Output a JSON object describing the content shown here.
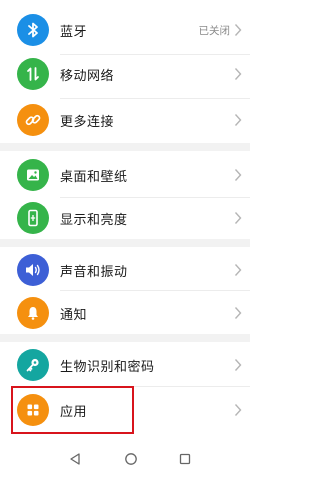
{
  "settings": {
    "items": [
      {
        "label": "蓝牙",
        "value": "已关闭",
        "icon": "bluetooth-icon",
        "color": "#1b8fe6"
      },
      {
        "label": "移动网络",
        "icon": "mobile-network-icon",
        "color": "#35b44a"
      },
      {
        "label": "更多连接",
        "icon": "link-icon",
        "color": "#f5900f"
      },
      {
        "label": "桌面和壁纸",
        "icon": "wallpaper-icon",
        "color": "#35b44a"
      },
      {
        "label": "显示和亮度",
        "icon": "display-icon",
        "color": "#35b44a"
      },
      {
        "label": "声音和振动",
        "icon": "sound-icon",
        "color": "#3d5fd6"
      },
      {
        "label": "通知",
        "icon": "bell-icon",
        "color": "#f5900f"
      },
      {
        "label": "生物识别和密码",
        "icon": "key-icon",
        "color": "#14a6a0"
      },
      {
        "label": "应用",
        "icon": "apps-icon",
        "color": "#f5900f"
      }
    ]
  },
  "highlight": {
    "target": "应用",
    "color": "#d8141c"
  },
  "nav": {
    "back_icon": "back-triangle-icon",
    "home_icon": "home-circle-icon",
    "recents_icon": "recents-square-icon"
  }
}
